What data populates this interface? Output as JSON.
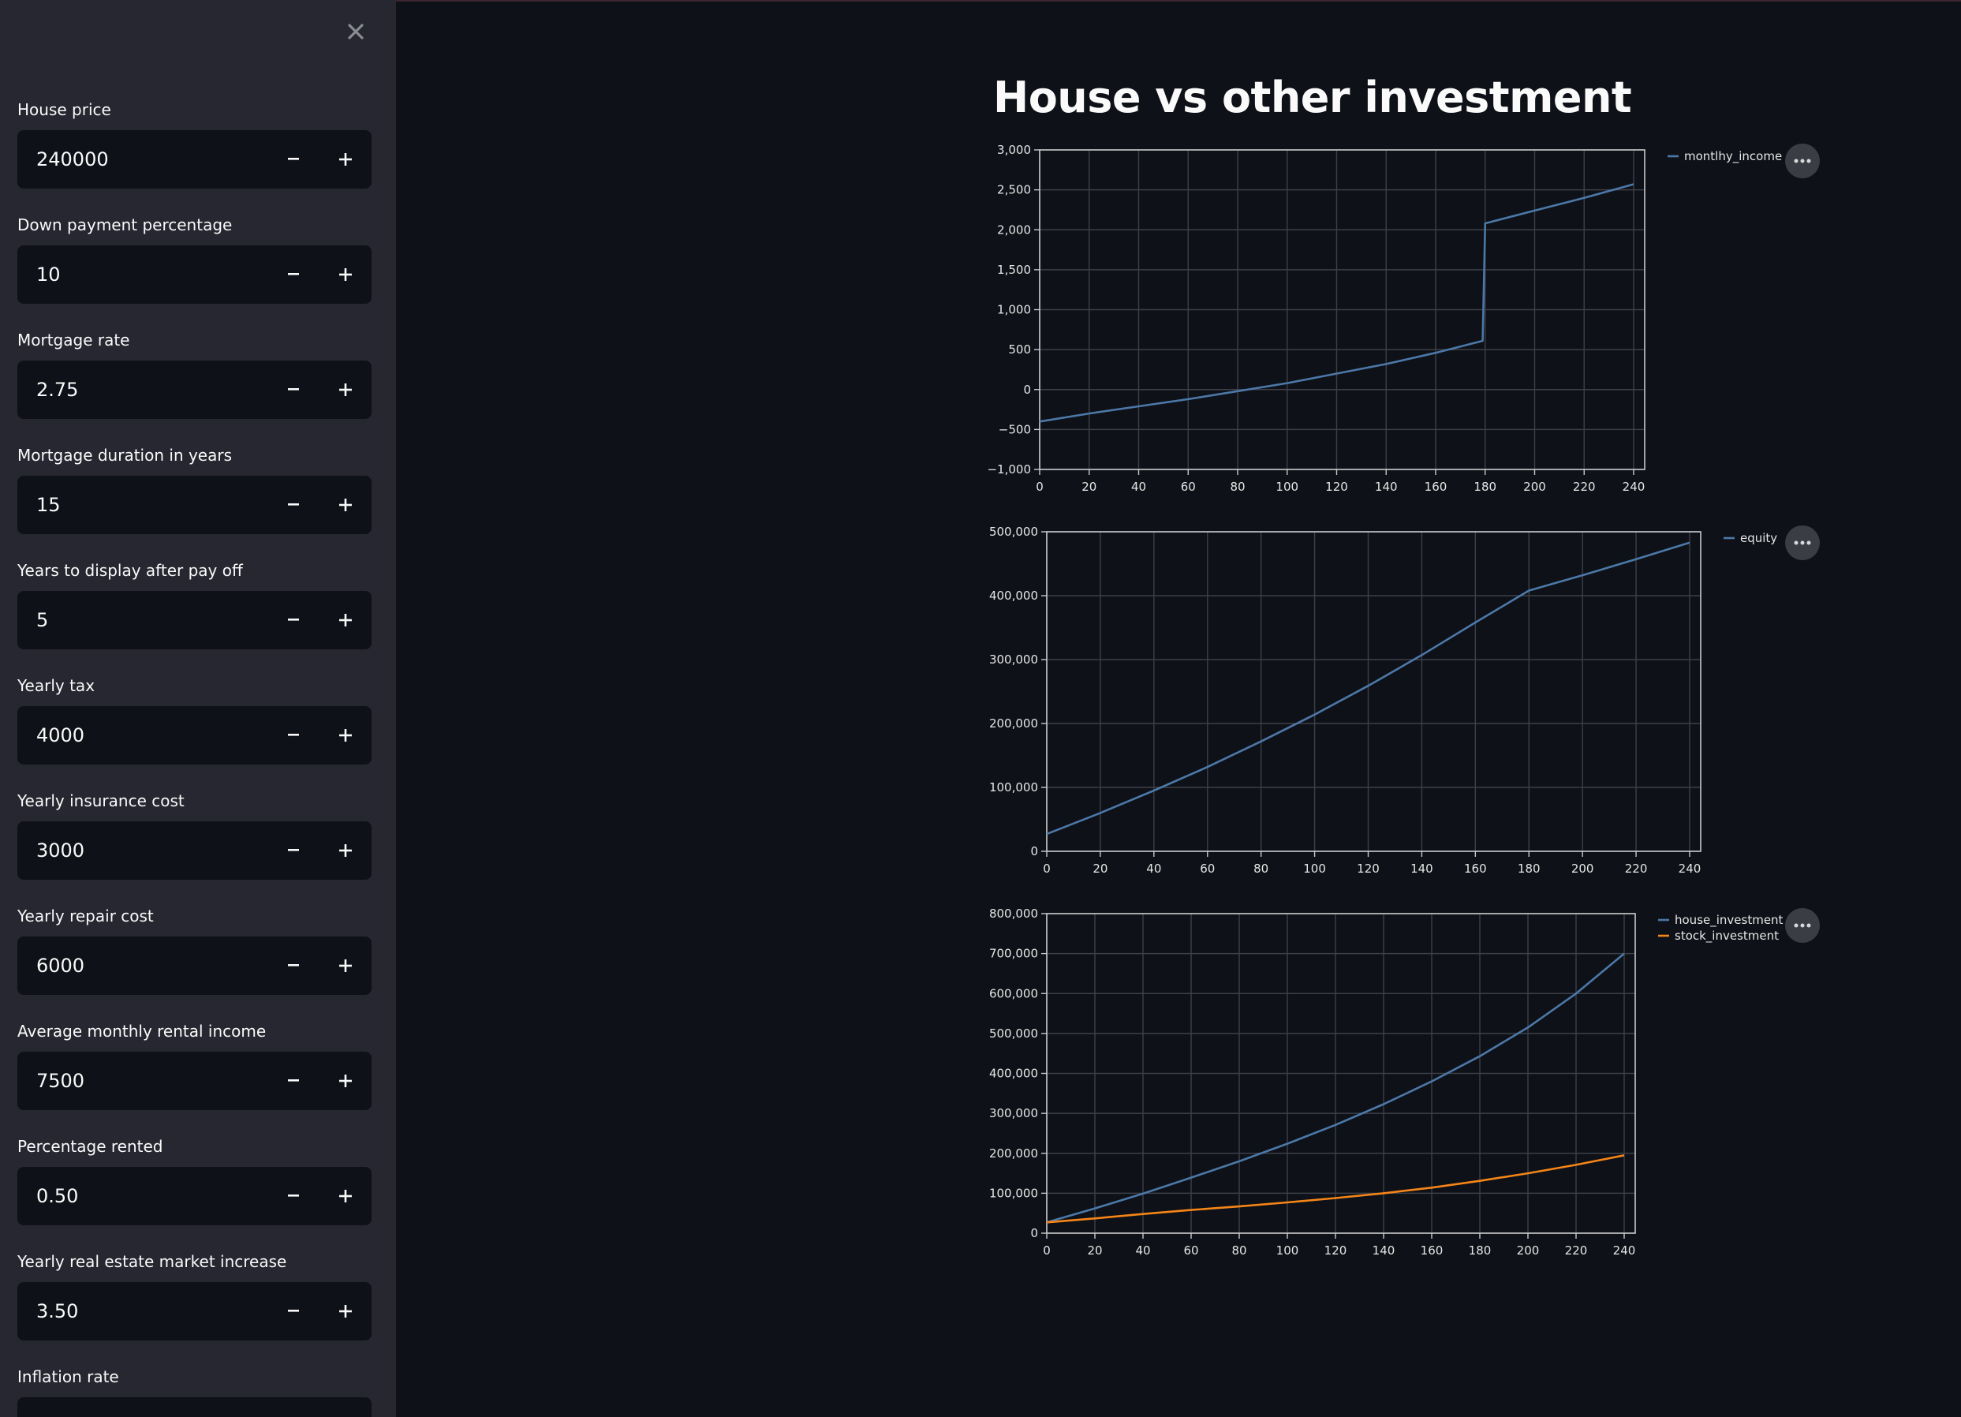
{
  "sidebar": {
    "close_icon": "close-icon",
    "fields": [
      {
        "label": "House price",
        "value": "240000"
      },
      {
        "label": "Down payment percentage",
        "value": "10"
      },
      {
        "label": "Mortgage rate",
        "value": "2.75"
      },
      {
        "label": "Mortgage duration in years",
        "value": "15"
      },
      {
        "label": "Years to display after pay off",
        "value": "5"
      },
      {
        "label": "Yearly tax",
        "value": "4000"
      },
      {
        "label": "Yearly insurance cost",
        "value": "3000"
      },
      {
        "label": "Yearly repair cost",
        "value": "6000"
      },
      {
        "label": "Average monthly rental income",
        "value": "7500"
      },
      {
        "label": "Percentage rented",
        "value": "0.50"
      },
      {
        "label": "Yearly real estate market increase",
        "value": "3.50"
      },
      {
        "label": "Inflation rate",
        "value": ""
      }
    ]
  },
  "main": {
    "title": "House vs other investment",
    "more_icon": "ellipsis-icon"
  },
  "colors": {
    "background": "#0e1117",
    "sidebar": "#262730",
    "series_blue": "#4c78a8",
    "series_orange": "#f58518"
  },
  "chart_data": [
    {
      "type": "line",
      "x_ticks": [
        0,
        20,
        40,
        60,
        80,
        100,
        120,
        140,
        160,
        180,
        200,
        220,
        240
      ],
      "y_ticks": [
        -1000,
        -500,
        0,
        500,
        1000,
        1500,
        2000,
        2500,
        3000
      ],
      "xlim": [
        0,
        240
      ],
      "ylim": [
        -1000,
        3000
      ],
      "grid": true,
      "legend": "top-right",
      "series": [
        {
          "name": "montlhy_income",
          "color": "#4c78a8",
          "x": [
            0,
            20,
            40,
            60,
            80,
            100,
            120,
            140,
            160,
            179,
            180,
            200,
            220,
            240
          ],
          "y": [
            -400,
            -300,
            -210,
            -120,
            -20,
            80,
            200,
            320,
            460,
            610,
            2080,
            2240,
            2400,
            2570
          ]
        }
      ]
    },
    {
      "type": "line",
      "x_ticks": [
        0,
        20,
        40,
        60,
        80,
        100,
        120,
        140,
        160,
        180,
        200,
        220,
        240
      ],
      "y_ticks": [
        0,
        100000,
        200000,
        300000,
        400000,
        500000
      ],
      "xlim": [
        0,
        240
      ],
      "ylim": [
        0,
        500000
      ],
      "grid": true,
      "legend": "top-right",
      "series": [
        {
          "name": "equity",
          "color": "#4c78a8",
          "x": [
            0,
            20,
            40,
            60,
            80,
            100,
            120,
            140,
            160,
            180,
            200,
            220,
            240
          ],
          "y": [
            27000,
            60000,
            95000,
            132000,
            172000,
            214000,
            259000,
            307000,
            358000,
            408000,
            432000,
            457000,
            483000
          ]
        }
      ]
    },
    {
      "type": "line",
      "x_ticks": [
        0,
        20,
        40,
        60,
        80,
        100,
        120,
        140,
        160,
        180,
        200,
        220,
        240
      ],
      "y_ticks": [
        0,
        100000,
        200000,
        300000,
        400000,
        500000,
        600000,
        700000,
        800000
      ],
      "xlim": [
        0,
        240
      ],
      "ylim": [
        0,
        800000
      ],
      "grid": true,
      "legend": "top-right",
      "series": [
        {
          "name": "house_investment",
          "color": "#4c78a8",
          "x": [
            0,
            20,
            40,
            60,
            80,
            100,
            120,
            140,
            160,
            180,
            200,
            220,
            240
          ],
          "y": [
            27000,
            62000,
            99000,
            139000,
            180000,
            224000,
            271000,
            323000,
            380000,
            443000,
            515000,
            600000,
            700000
          ]
        },
        {
          "name": "stock_investment",
          "color": "#f58518",
          "x": [
            0,
            20,
            40,
            60,
            80,
            100,
            120,
            140,
            160,
            180,
            200,
            220,
            240
          ],
          "y": [
            27000,
            37000,
            48000,
            58000,
            67000,
            77000,
            88000,
            100000,
            114000,
            131000,
            150000,
            171000,
            195000
          ]
        }
      ]
    }
  ]
}
